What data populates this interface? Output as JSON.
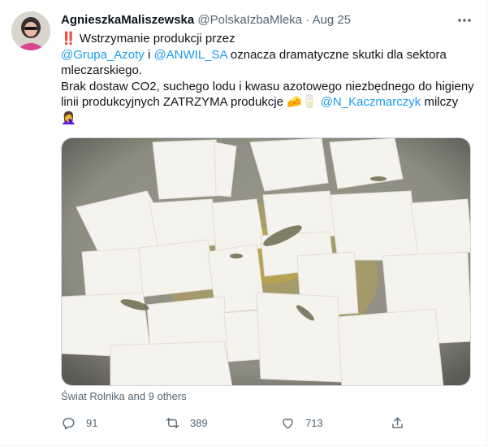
{
  "author": {
    "name": "AgnieszkaMaliszewska",
    "handle": "@PolskaIzbaMleka",
    "separator": "·",
    "date": "Aug 25"
  },
  "tweet": {
    "line1_prefix": "‼️",
    "line1_text": "Wstrzymanie produkcji przez",
    "mention1": "@Grupa_Azoty",
    "conj": " i ",
    "mention2": "@ANWIL_SA",
    "line2_rest": " oznacza dramatyczne skutki dla sektora",
    "line3": "mleczarskiego.",
    "line4": "Brak dostaw CO2, suchego lodu i kwasu azotowego niezbędnego do higieny",
    "line5_pre": "linii produkcyjnych ZATRZYMA produkcje ",
    "line5_emoji": "🧀🥛",
    "mention3": "@N_Kaczmarczyk",
    "line5_post": " milczy",
    "line6_emoji": "🤦‍♀️"
  },
  "likes_line": "Świat Rolnika and 9 others",
  "actions": {
    "replies": "91",
    "retweets": "389",
    "likes": "713"
  },
  "icons": [
    "more-icon",
    "reply-icon",
    "retweet-icon",
    "like-icon",
    "share-icon"
  ],
  "colors": {
    "accent": "#1d9bf0",
    "secondary_text": "#536471",
    "border": "#cfd9de"
  }
}
